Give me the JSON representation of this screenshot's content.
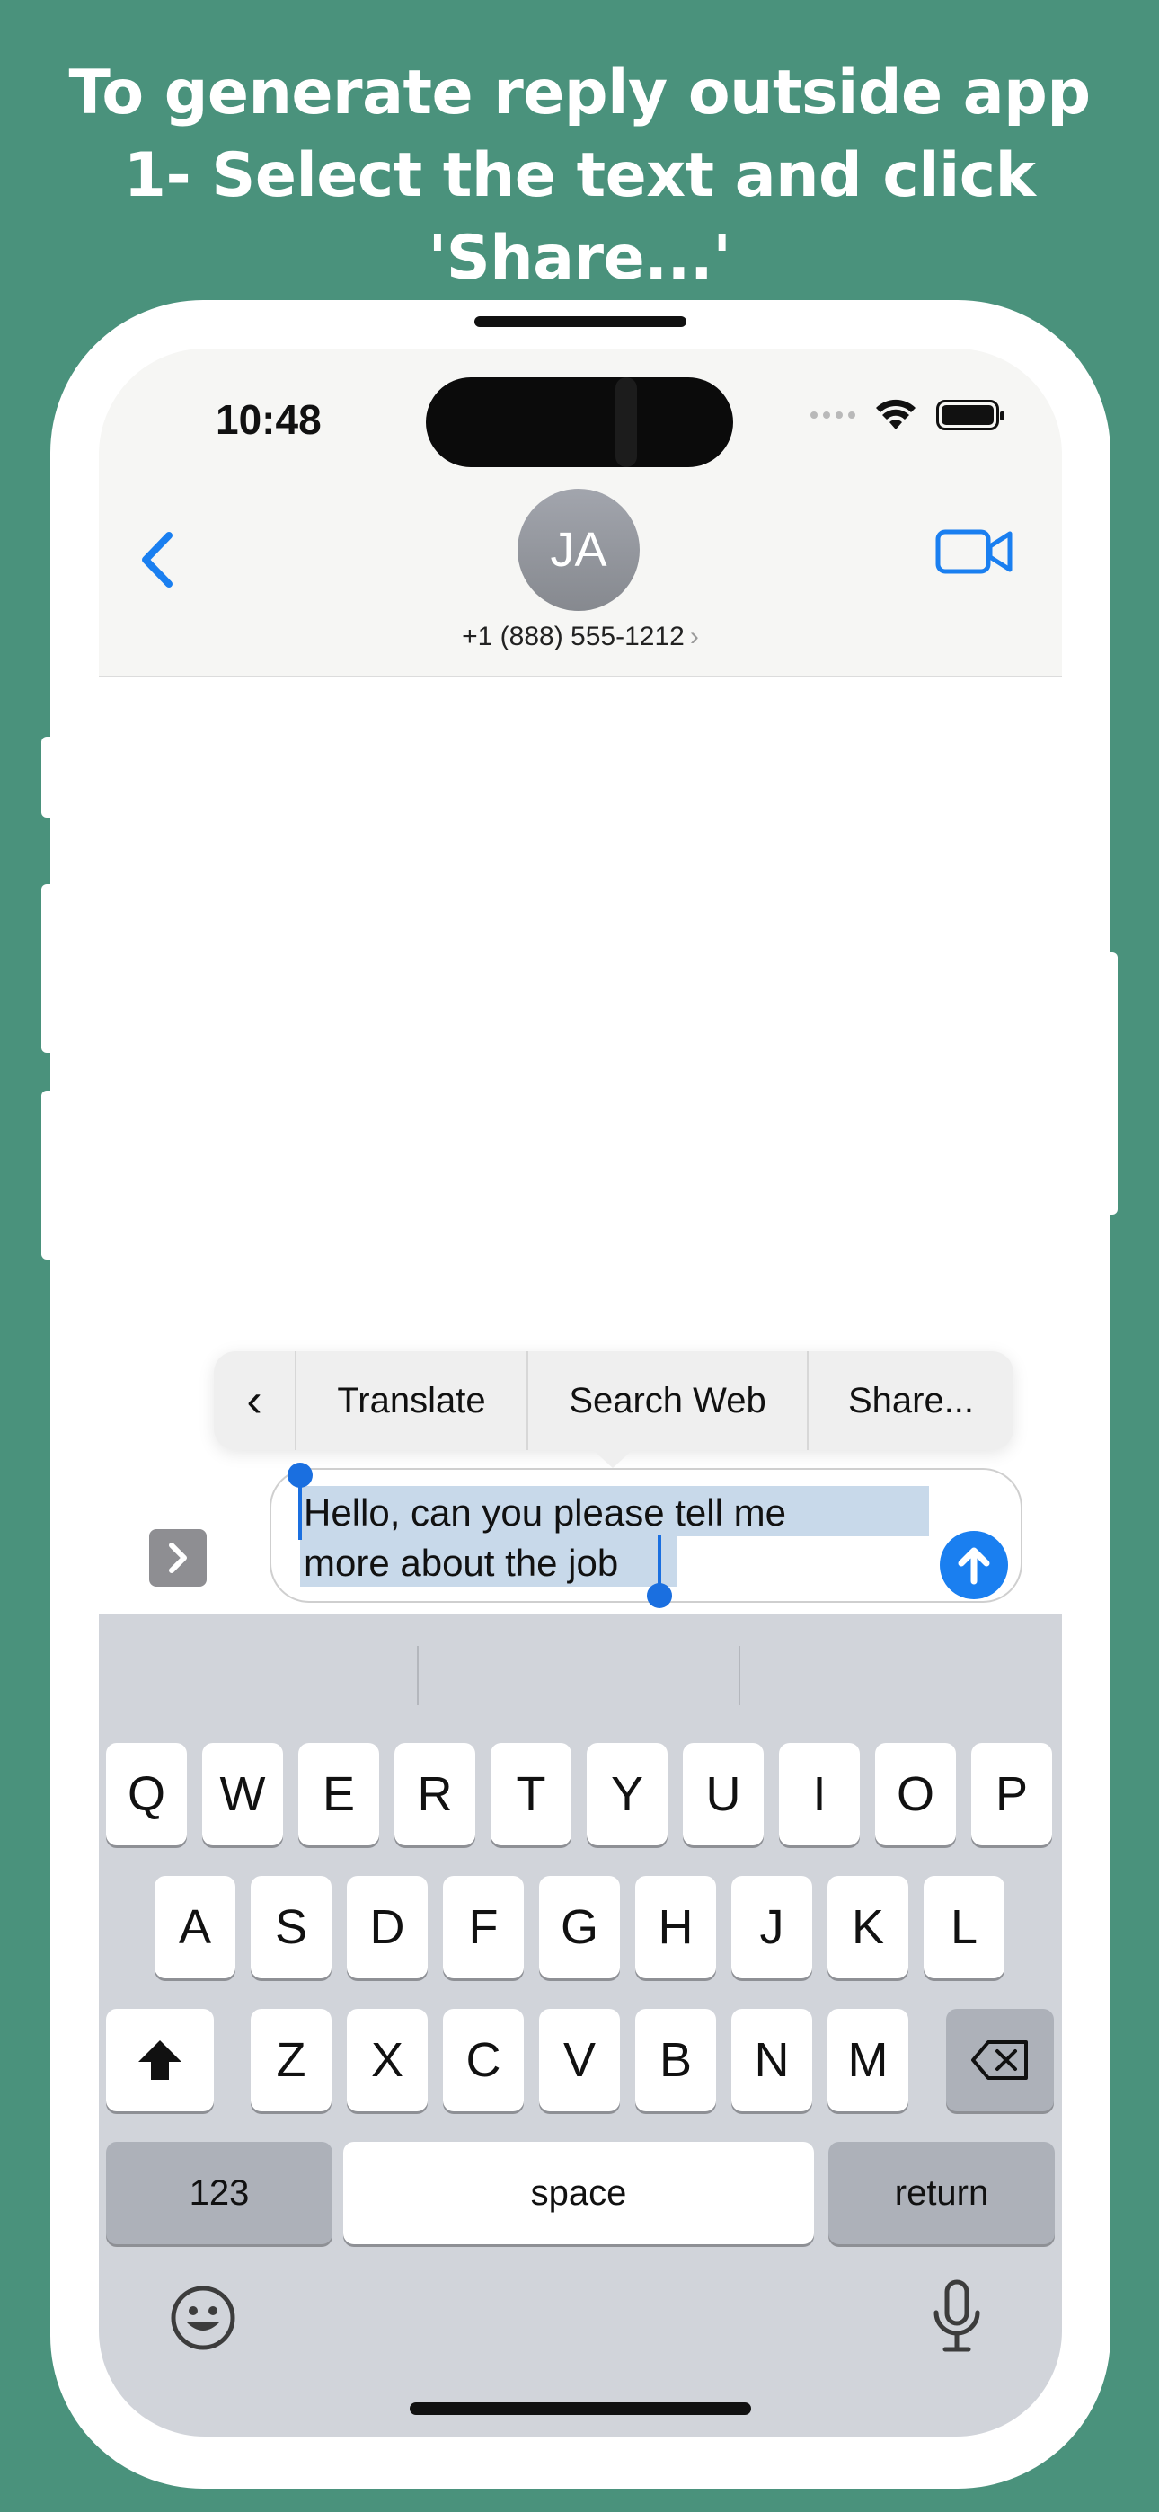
{
  "headline": {
    "line1": "To generate reply outside app",
    "line2": "1- Select the text and click 'Share...'"
  },
  "status_bar": {
    "time": "10:48"
  },
  "conversation": {
    "avatar_initials": "JA",
    "contact": "+1 (888) 555-1212",
    "contact_chevron": "›"
  },
  "context_menu": {
    "back_glyph": "‹",
    "items": [
      "Translate",
      "Search Web",
      "Share..."
    ]
  },
  "composer": {
    "expand_glyph": "›",
    "message_line1": "Hello, can you please tell me",
    "message_line2": "more about the job"
  },
  "keyboard": {
    "row1": [
      "Q",
      "W",
      "E",
      "R",
      "T",
      "Y",
      "U",
      "I",
      "O",
      "P"
    ],
    "row2": [
      "A",
      "S",
      "D",
      "F",
      "G",
      "H",
      "J",
      "K",
      "L"
    ],
    "row3": [
      "Z",
      "X",
      "C",
      "V",
      "B",
      "N",
      "M"
    ],
    "numbers_label": "123",
    "space_label": "space",
    "return_label": "return"
  },
  "colors": {
    "background": "#4a927c",
    "ios_blue": "#1a7ff0",
    "selection": "#c8d9ea"
  }
}
